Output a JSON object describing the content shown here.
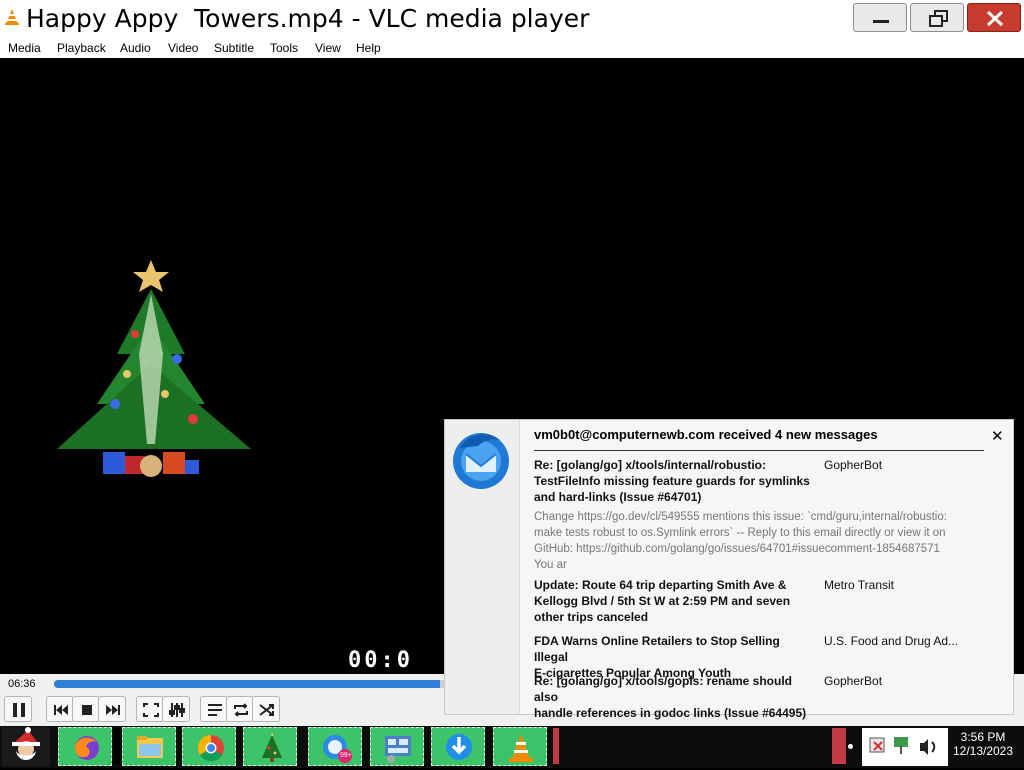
{
  "window": {
    "title": "Happy Appy  Towers.mp4 - VLC media player"
  },
  "menu": [
    "Media",
    "Playback",
    "Audio",
    "Video",
    "Subtitle",
    "Tools",
    "View",
    "Help"
  ],
  "video": {
    "timecode_overlay": "00:0"
  },
  "player": {
    "elapsed": "06:36",
    "progress": 0.42
  },
  "notification": {
    "header": "vm0b0t@computernewb.com received 4 new messages",
    "messages": [
      {
        "subject_lines": [
          "Re: [golang/go] x/tools/internal/robustio:",
          "TestFileInfo missing feature guards for symlinks",
          "and hard-links (Issue #64701)"
        ],
        "from": "GopherBot",
        "preview_lines": [
          "Change https://go.dev/cl/549555 mentions this issue: `cmd/guru,internal/robustio:",
          "make tests robust to os.Symlink errors` -- Reply to this email directly or view it on",
          "GitHub: https://github.com/golang/go/issues/64701#issuecomment-1854687571",
          "You ar"
        ]
      },
      {
        "subject_lines": [
          "Update: Route 64 trip departing Smith Ave &",
          "Kellogg Blvd / 5th St W at 2:59 PM and seven",
          "other trips canceled"
        ],
        "from": "Metro Transit"
      },
      {
        "subject_lines": [
          "FDA Warns Online Retailers to Stop Selling Illegal",
          "E-cigarettes Popular Among Youth"
        ],
        "from": "U.S. Food and Drug Ad..."
      },
      {
        "subject_lines": [
          "Re: [golang/go] x/tools/gopls: rename should also",
          "handle references in godoc links (Issue #64495)"
        ],
        "from": "GopherBot"
      }
    ]
  },
  "taskbar": {
    "items": [
      "santa-icon",
      "firefox-icon",
      "file-explorer-icon",
      "chrome-icon",
      "christmas-tree-icon",
      "messenger-icon",
      "control-panel-icon",
      "download-icon",
      "vlc-icon"
    ],
    "messenger_badge": "99+",
    "clock_time": "3:56 PM",
    "clock_date": "12/13/2023"
  },
  "colors": {
    "seek_fill": "#2f7fd6",
    "taskbar_button": "#3dc46a",
    "close_red": "#c73b2e",
    "thunderbird_blue": "#1f79d6"
  }
}
